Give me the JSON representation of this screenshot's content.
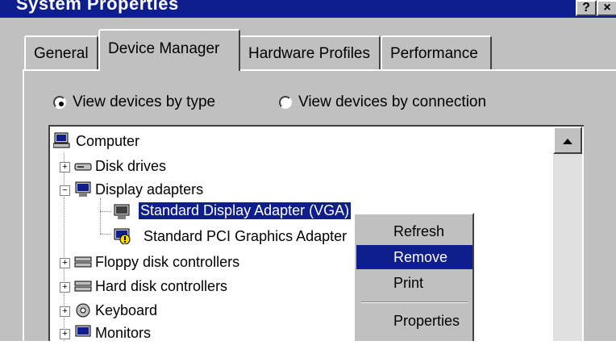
{
  "window": {
    "title": "System Properties"
  },
  "tabs": [
    {
      "label": "General"
    },
    {
      "label": "Device Manager"
    },
    {
      "label": "Hardware Profiles"
    },
    {
      "label": "Performance"
    }
  ],
  "view_options": [
    {
      "label": "View devices by type",
      "checked": true
    },
    {
      "label": "View devices by connection",
      "checked": false
    }
  ],
  "tree": {
    "root": "Computer",
    "items": [
      {
        "label": "Disk drives",
        "expanded": false,
        "icon": "disk-drive-icon"
      },
      {
        "label": "Display adapters",
        "expanded": true,
        "icon": "monitor-icon"
      },
      {
        "label": "Standard Display Adapter (VGA)",
        "selected": true,
        "icon": "display-adapter-icon"
      },
      {
        "label": "Standard PCI Graphics Adapter",
        "warning": true,
        "icon": "display-adapter-warning-icon"
      },
      {
        "label": "Floppy disk controllers",
        "expanded": false,
        "icon": "controller-icon"
      },
      {
        "label": "Hard disk controllers",
        "expanded": false,
        "icon": "controller-icon"
      },
      {
        "label": "Keyboard",
        "expanded": false,
        "icon": "keyboard-icon"
      },
      {
        "label": "Monitors",
        "expanded": false,
        "icon": "monitor-icon"
      }
    ]
  },
  "context_menu": {
    "items": [
      {
        "label": "Refresh"
      },
      {
        "label": "Remove",
        "highlighted": true
      },
      {
        "label": "Print"
      },
      {
        "label": "Properties"
      }
    ]
  },
  "colors": {
    "face": "#c0c0c0",
    "highlight": "#0e1e8c",
    "window": "#ffffff",
    "warning": "#ffd700"
  }
}
